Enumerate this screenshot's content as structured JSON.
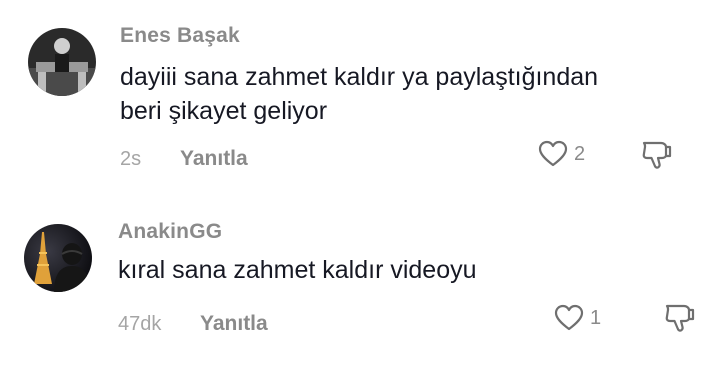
{
  "comments": [
    {
      "username": "Enes Başak",
      "text_line1": "dayiii sana zahmet kaldır ya paylaştığından",
      "text_line2": "beri şikayet geliyor",
      "time": "2s",
      "reply_label": "Yanıtla",
      "likes": "2"
    },
    {
      "username": "AnakinGG",
      "text_line1": "kıral sana zahmet kaldır videoyu",
      "time": "47dk",
      "reply_label": "Yanıtla",
      "likes": "1"
    }
  ],
  "icons": {
    "like": "heart-outline-icon",
    "dislike": "thumbs-down-icon"
  },
  "colors": {
    "text": "#161823",
    "muted": "#8a8a8a",
    "time": "#a5a5a5"
  }
}
